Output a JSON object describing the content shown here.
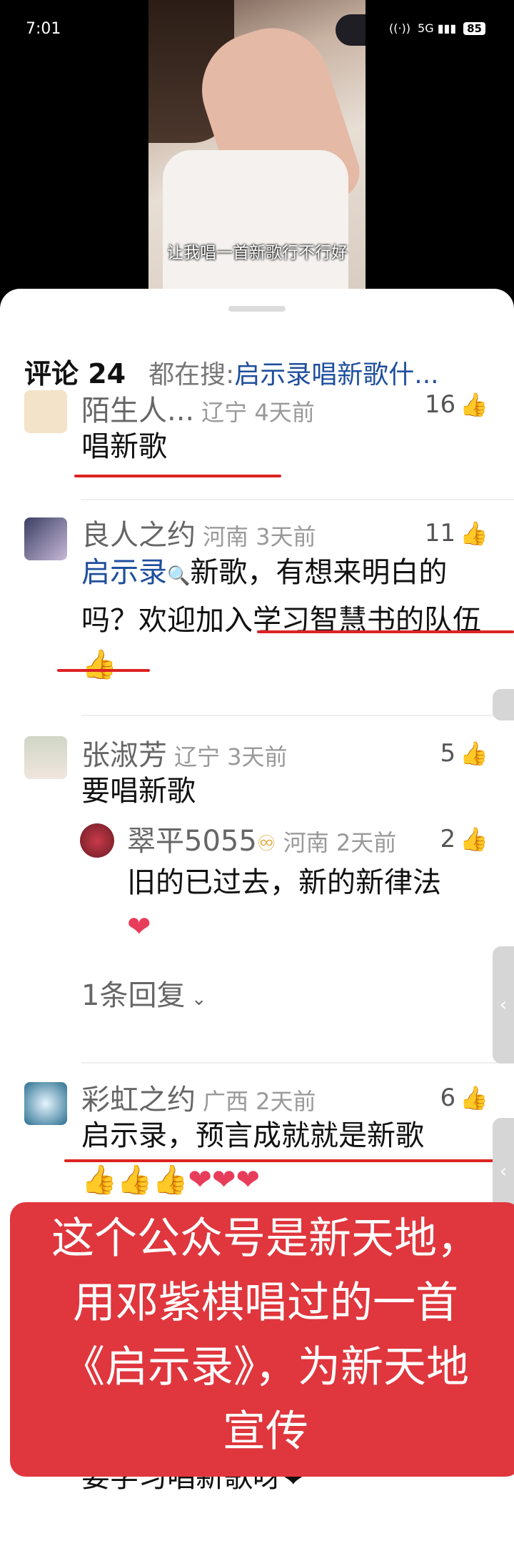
{
  "status_bar": {
    "time": "7:01",
    "network": "5G",
    "battery": "85"
  },
  "video": {
    "subtitle": "让我唱一首新歌行不行好"
  },
  "sheet": {
    "title": "评论 24",
    "search_prefix": "都在搜:",
    "search_link": "启示录唱新歌什..."
  },
  "comments": [
    {
      "name": "陌生人...",
      "meta": "辽宁 4天前",
      "likes": "16",
      "text": "唱新歌"
    },
    {
      "name": "良人之约",
      "meta": "河南 3天前",
      "likes": "11",
      "text_link": "启示录",
      "text": "新歌，有想来明白的吗？欢迎加入学习智慧书的队伍👍"
    },
    {
      "name": "张淑芳",
      "meta": "辽宁 3天前",
      "likes": "5",
      "text": "要唱新歌",
      "reply": {
        "name": "翠平5055",
        "badge": "♾",
        "meta": "河南 2天前",
        "likes": "2",
        "text": "旧的已过去，新的新律法",
        "emoji": "❤"
      },
      "reply_toggle": "1条回复"
    },
    {
      "name": "彩虹之约",
      "meta": "广西 2天前",
      "likes": "6",
      "text": "启示录，预言成就就是新歌",
      "emoji": "👍👍👍❤❤❤"
    }
  ],
  "overlay_banner": {
    "lines": [
      "这个公众号是新天地，",
      "用邓紫棋唱过的一首",
      "《启示录》，为新天地",
      "宣传"
    ]
  },
  "bottom_partial_text": "要学习唱新歌呀❤"
}
